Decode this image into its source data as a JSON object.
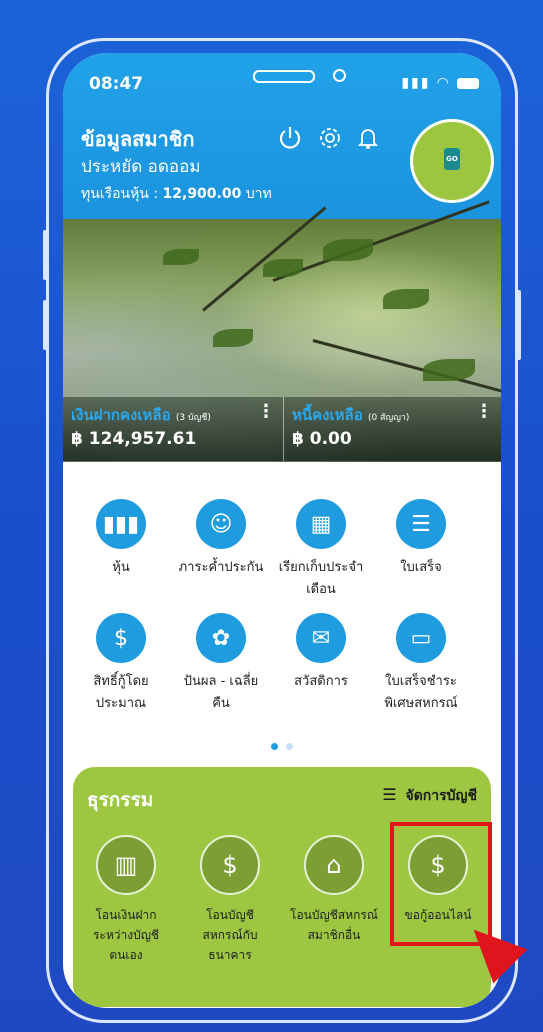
{
  "status_bar": {
    "time": "08:47",
    "signal_icon": "signal-icon",
    "wifi_icon": "wifi-icon",
    "battery_icon": "battery-icon"
  },
  "header": {
    "title": "ข้อมูลสมาชิก",
    "member_name": "ประหยัด อดออม",
    "shares_label": "ทุนเรือนหุ้น :",
    "shares_value": "12,900.00",
    "shares_unit": "บาท",
    "icons": [
      "power-icon",
      "settings-icon",
      "bell-icon"
    ],
    "avatar_logo_text": "GO"
  },
  "cards": {
    "deposit": {
      "title": "เงินฝากคงเหลือ",
      "count": "(3 บัญชี)",
      "amount": "฿ 124,957.61"
    },
    "debt": {
      "title": "หนี้คงเหลือ",
      "count": "(0 สัญญา)",
      "amount": "฿ 0.00"
    }
  },
  "menu": [
    {
      "label": "หุ้น",
      "icon": "bar-chart-icon"
    },
    {
      "label": "ภาระค้ำประกัน",
      "icon": "people-icon"
    },
    {
      "label": "เรียกเก็บประจำเดือน",
      "icon": "calendar-icon"
    },
    {
      "label": "ใบเสร็จ",
      "icon": "receipt-icon"
    },
    {
      "label": "สิทธิ์กู้โดยประมาณ",
      "icon": "document-icon"
    },
    {
      "label": "ปันผล - เฉลี่ยคืน",
      "icon": "plant-coin-icon"
    },
    {
      "label": "สวัสดิการ",
      "icon": "gift-icon"
    },
    {
      "label": "ใบเสร็จชำระพิเศษสหกรณ์",
      "icon": "card-payment-icon"
    }
  ],
  "pagination": {
    "pages": 2,
    "active": 1,
    "active_color": "#1f9be0",
    "inactive_color": "#c8dff5"
  },
  "transactions": {
    "title": "ธุรกรรม",
    "manage_label": "จัดการบัญชี",
    "items": [
      {
        "label": "โอนเงินฝากระหว่างบัญชีตนเอง",
        "icon": "bank-transfer-icon"
      },
      {
        "label": "โอนบัญชีสหกรณ์กับธนาคาร",
        "icon": "coin-exchange-icon"
      },
      {
        "label": "โอนบัญชีสหกรณ์สมาชิกอื่น",
        "icon": "bank-icon"
      },
      {
        "label": "ขอกู้ออนไลน์",
        "icon": "loan-hand-icon"
      }
    ]
  },
  "colors": {
    "header_blue": "#1f9be0",
    "panel_green": "#9dc641",
    "highlight_red": "#e0141c"
  }
}
